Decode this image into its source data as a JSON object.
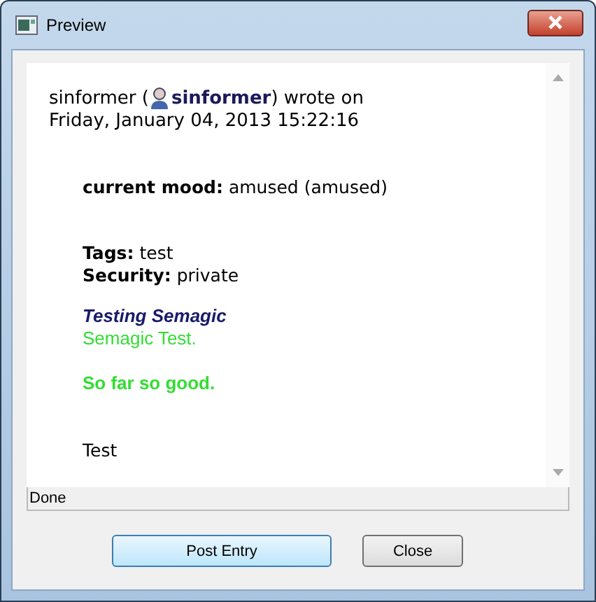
{
  "window": {
    "title": "Preview"
  },
  "entry": {
    "author": "sinformer (",
    "user_link": "sinformer",
    "wrote": ") wrote on",
    "date": "Friday, January 04, 2013 15:22:16",
    "mood_label": "current mood:",
    "mood_value": "amused (amused)",
    "tags_label": "Tags:",
    "tags_value": "test",
    "security_label": "Security:",
    "security_value": "private",
    "lines": [
      {
        "kind": "subject",
        "text": "Testing Semagic"
      },
      {
        "kind": "green",
        "text": "Semagic Test."
      },
      {
        "kind": "gap"
      },
      {
        "kind": "green-bold",
        "text": "So far so good."
      },
      {
        "kind": "gap"
      },
      {
        "kind": "gap"
      },
      {
        "kind": "plain",
        "text": "Test"
      }
    ]
  },
  "status_bar": "Done",
  "buttons": [
    "Post Entry",
    "Close"
  ]
}
